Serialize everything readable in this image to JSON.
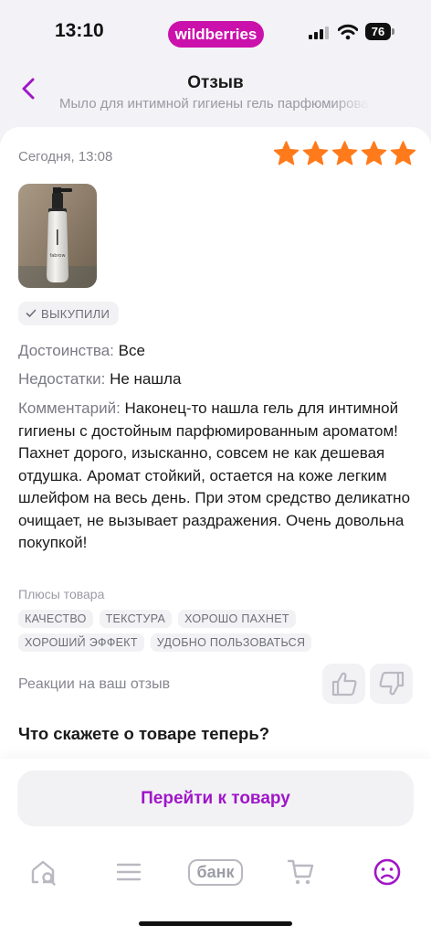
{
  "status_bar": {
    "time": "13:10",
    "brand": "wildberries",
    "battery": "76"
  },
  "header": {
    "title": "Отзыв",
    "subtitle": "Мыло для интимной гигиены гель парфюмированный"
  },
  "review": {
    "date": "Сегодня, 13:08",
    "rating": 5,
    "photo_label": "fabrow",
    "badge": "ВЫКУПИЛИ",
    "pros_label": "Достоинства:",
    "pros": "Все",
    "cons_label": "Недостатки:",
    "cons": "Не нашла",
    "comment_label": "Комментарий:",
    "comment": "Наконец-то нашла гель для интимной гигиены с достойным парфюмированным ароматом! Пахнет дорого, изысканно, совсем не как дешевая отдушка. Аромат стойкий, остается на коже легким шлейфом на весь день. При этом средство деликатно очищает, не вызывает раздражения. Очень довольна покупкой!",
    "tags_label": "Плюсы товара",
    "tags": [
      "КАЧЕСТВО",
      "ТЕКСТУРА",
      "ХОРОШО ПАХНЕТ",
      "ХОРОШИЙ ЭФФЕКТ",
      "УДОБНО ПОЛЬЗОВАТЬСЯ"
    ],
    "reactions_label": "Реакции на ваш отзыв",
    "question": "Что скажете о товаре теперь?"
  },
  "actions": {
    "goto_product": "Перейти к товару"
  },
  "tabbar": {
    "bank_label": "банк"
  },
  "colors": {
    "brand": "#cb11ab",
    "accent": "#a016c8",
    "star": "#ff7a1a"
  },
  "icons": [
    "back-chevron-icon",
    "star-icon",
    "check-icon",
    "thumbs-up-icon",
    "thumbs-down-icon",
    "home-search-icon",
    "catalog-menu-icon",
    "cart-icon",
    "profile-icon"
  ]
}
